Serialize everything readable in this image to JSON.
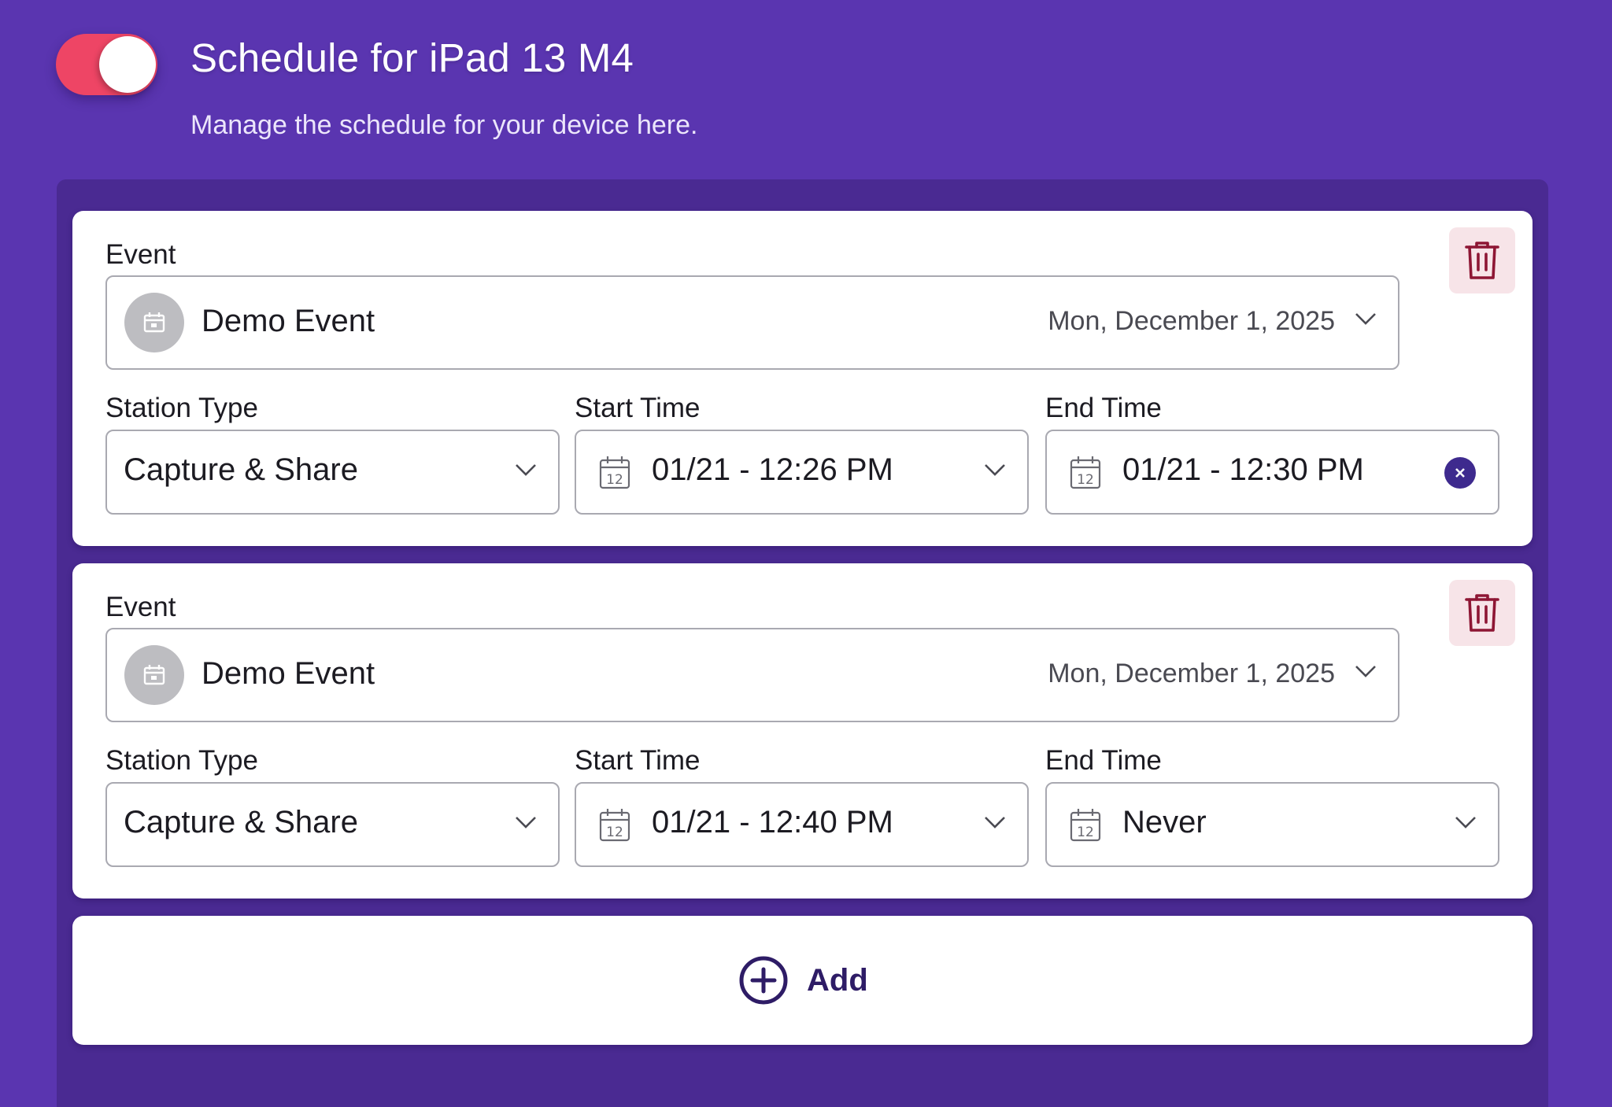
{
  "header": {
    "title": "Schedule for iPad 13 M4",
    "subtitle": "Manage the schedule for your device here.",
    "toggle_on": true
  },
  "labels": {
    "event": "Event",
    "station_type": "Station Type",
    "start_time": "Start Time",
    "end_time": "End Time"
  },
  "schedules": [
    {
      "event_name": "Demo Event",
      "event_date": "Mon, December 1, 2025",
      "station_type": "Capture & Share",
      "start_time": "01/21 - 12:26 PM",
      "end_time": "01/21 - 12:30 PM"
    },
    {
      "event_name": "Demo Event",
      "event_date": "Mon, December 1, 2025",
      "station_type": "Capture & Share",
      "start_time": "01/21 - 12:40 PM",
      "end_time": "Never"
    }
  ],
  "add_button": {
    "label": "Add"
  },
  "icons": {
    "calendar_day": "12"
  },
  "colors": {
    "background": "#5a35b0",
    "panel": "#4a2a92",
    "toggle": "#ee4565",
    "delete_bg": "#f7e4e8",
    "delete_icon": "#8e1634",
    "clear_button": "#3e2a8e",
    "add_accent": "#2e1c66"
  }
}
